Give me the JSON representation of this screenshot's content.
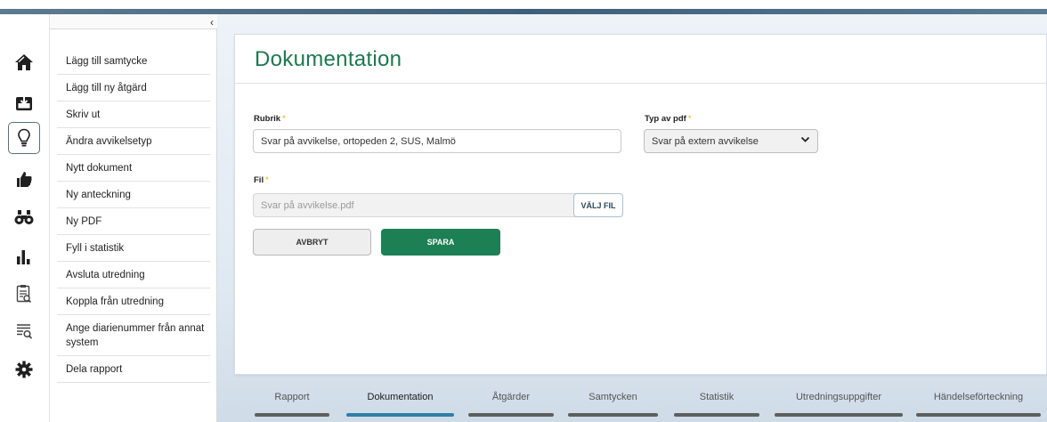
{
  "sidebar": {
    "collapse_glyph": "‹",
    "icons": [
      "home-icon",
      "inbox-icon",
      "lightbulb-icon",
      "thumbs-up-icon",
      "binoculars-icon",
      "bar-chart-icon",
      "report-search-icon",
      "list-search-icon",
      "gear-icon"
    ]
  },
  "menu": {
    "items": [
      "Lägg till samtycke",
      "Lägg till ny åtgärd",
      "Skriv ut",
      "Ändra avvikelsetyp",
      "Nytt dokument",
      "Ny anteckning",
      "Ny PDF",
      "Fyll i statistik",
      "Avsluta utredning",
      "Koppla från utredning",
      "Ange diarienummer från annat system",
      "Dela rapport"
    ]
  },
  "form": {
    "title": "Dokumentation",
    "rubrik_label": "Rubrik",
    "rubrik_value": "Svar på avvikelse, ortopeden 2, SUS, Malmö",
    "pdf_type_label": "Typ av pdf",
    "pdf_type_value": "Svar på extern avvikelse",
    "file_label": "Fil",
    "file_placeholder": "Svar på avvikelse.pdf",
    "choose_file_label": "VÄLJ FIL",
    "cancel_label": "AVBRYT",
    "save_label": "SPARA",
    "required_marker": "*"
  },
  "tabs": [
    "Rapport",
    "Dokumentation",
    "Åtgärder",
    "Samtycken",
    "Statistik",
    "Utredningsuppgifter",
    "Händelseförteckning"
  ],
  "active_tab": "Dokumentation",
  "colors": {
    "accent_green": "#1d7f54",
    "title_green": "#1a7a4e",
    "active_tab": "#2f7fa8",
    "required": "#f0a500"
  }
}
